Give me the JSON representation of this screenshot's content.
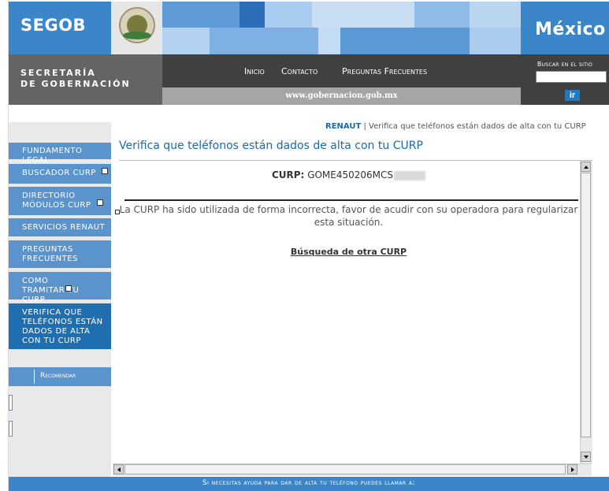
{
  "header": {
    "brand": "SEGOB",
    "country": "México",
    "department_line1": "SECRETARÍA",
    "department_line2": "DE GOBERNACIÓN",
    "nav": [
      "Inicio",
      "Contacto",
      "Preguntas Frecuentes"
    ],
    "url": "www.gobernacion.gob.mx",
    "search_label": "Buscar en el sitio",
    "search_value": "",
    "search_button": "ir"
  },
  "sidebar": {
    "items": [
      {
        "label": "FUNDAMENTO LEGAL"
      },
      {
        "label": "BUSCADOR CURP"
      },
      {
        "label": "DIRECTORIO MÓDULOS CURP"
      },
      {
        "label": "SERVICIOS RENAUT"
      },
      {
        "label": "PREGUNTAS FRECUENTES"
      },
      {
        "label": "COMO TRAMITAR TU CURP"
      },
      {
        "label": "VERIFICA QUE TELÉFONOS ESTÁN DADOS DE ALTA CON TU CURP"
      }
    ],
    "recommend": "Recomendar"
  },
  "breadcrumb": {
    "root": "RENAUT",
    "separator": "|",
    "current": "Verifica que teléfonos están dados de alta con tu CURP"
  },
  "main": {
    "title": "Verifica que teléfonos están dados de alta con tu CURP",
    "curp_label": "CURP:",
    "curp_value": "GOME450206MCS",
    "error_message": "La CURP ha sido utilizada de forma incorrecta, favor de acudir con su operadora para regularizar esta situación.",
    "search_again": "Búsqueda de otra CURP"
  },
  "footer": {
    "text": "Si necesitas ayuda para dar de alta tu teléfono puedes llamar a:"
  },
  "colors": {
    "brand_blue": "#3a86c8",
    "dark_gray": "#404040",
    "title_blue": "#1b6aa8"
  }
}
